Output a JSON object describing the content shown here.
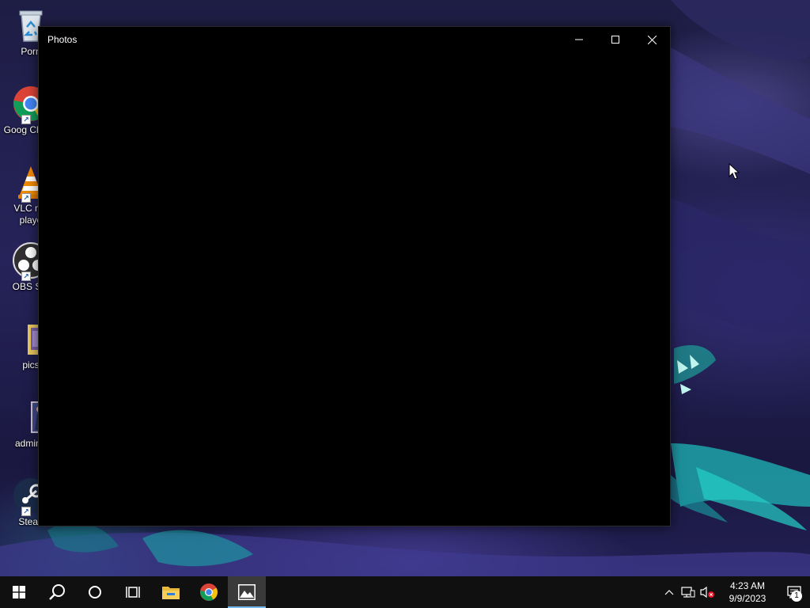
{
  "desktop": {
    "icons": [
      {
        "label": "Porn",
        "icon": "recycle-bin-icon"
      },
      {
        "label": "Goog Chrom",
        "icon": "chrome-icon"
      },
      {
        "label": "VLC me playe",
        "icon": "vlc-icon"
      },
      {
        "label": "OBS Stu",
        "icon": "obs-icon"
      },
      {
        "label": "pics",
        "icon": "folder-icon"
      },
      {
        "label": "admin r",
        "icon": "image-file-icon"
      },
      {
        "label": "Stean",
        "icon": "steam-icon"
      }
    ]
  },
  "window": {
    "title": "Photos",
    "controls": [
      "minimize-icon",
      "maximize-icon",
      "close-icon"
    ],
    "background": "#000000"
  },
  "taskbar": {
    "items": [
      "windows-start-icon",
      "search-icon",
      "cortana-icon",
      "task-view-icon",
      "file-explorer-icon",
      "chrome-icon",
      "photos-icon"
    ],
    "active_item": "photos-icon",
    "accent": "#76b9ed",
    "tray": {
      "icons": [
        "chevron-up-icon",
        "network-icon",
        "volume-muted-icon"
      ],
      "time": "4:23 AM",
      "date": "9/9/2023",
      "notification_count": "1"
    }
  }
}
